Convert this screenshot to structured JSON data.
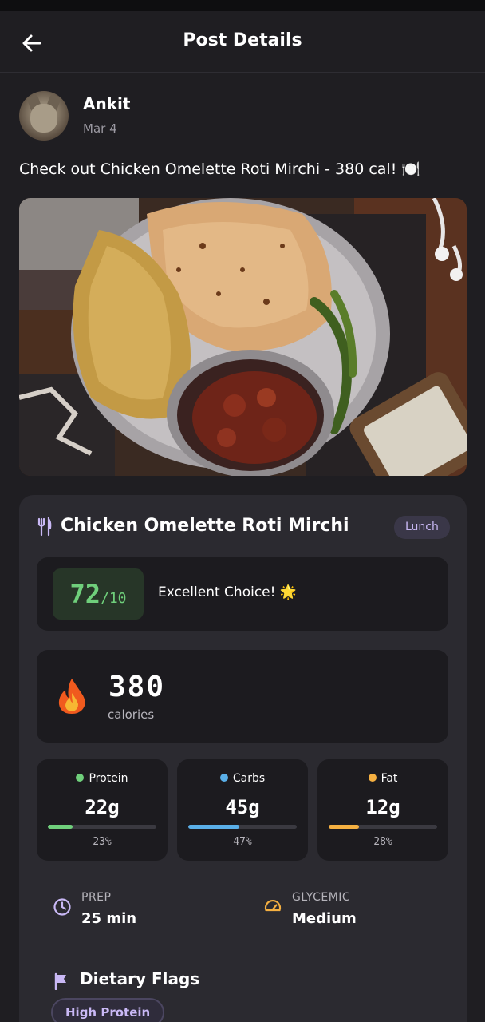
{
  "header": {
    "title": "Post Details"
  },
  "author": {
    "name": "Ankit",
    "date": "Mar 4"
  },
  "post": {
    "caption": "Check out Chicken Omelette Roti Mirchi - 380 cal! 🍽️"
  },
  "meal": {
    "name": "Chicken Omelette Roti Mirchi",
    "meal_type": "Lunch",
    "score": {
      "value": "72",
      "max": "/10",
      "label": "Excellent Choice! 🌟"
    },
    "calories": {
      "value": "380",
      "label": "calories"
    },
    "macros": [
      {
        "name": "Protein",
        "value": "22g",
        "percent_label": "23%",
        "percent": 23,
        "color": "#6fcf7b"
      },
      {
        "name": "Carbs",
        "value": "45g",
        "percent_label": "47%",
        "percent": 47,
        "color": "#5aafe8"
      },
      {
        "name": "Fat",
        "value": "12g",
        "percent_label": "28%",
        "percent": 28,
        "color": "#f5b041"
      }
    ],
    "prep": {
      "label": "PREP",
      "value": "25 min",
      "icon": "clock-icon"
    },
    "glycemic": {
      "label": "GLYCEMIC",
      "value": "Medium",
      "icon": "gauge-icon"
    },
    "dietary_flags": {
      "title": "Dietary Flags",
      "items": [
        "High Protein"
      ]
    }
  },
  "colors": {
    "accent": "#c9b8f5",
    "score": "#6fcf7b",
    "background": "#1f1e22",
    "card": "#2b2a30"
  }
}
